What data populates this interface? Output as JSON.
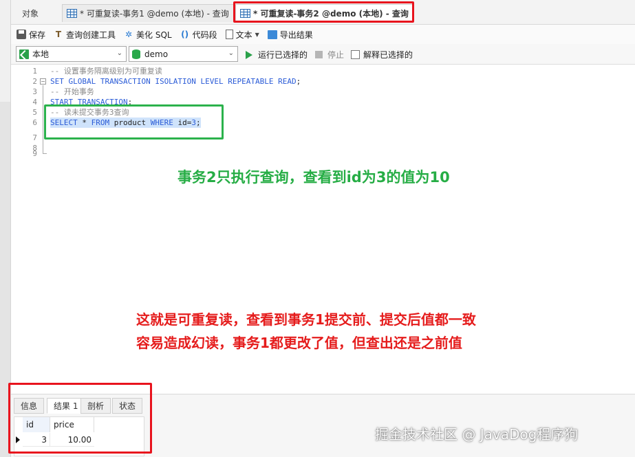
{
  "tabs": [
    {
      "label": "对象"
    },
    {
      "label": "* 可重复读-事务1 @demo (本地) - 查询"
    },
    {
      "label": "* 可重复读-事务2 @demo (本地) - 查询"
    }
  ],
  "toolbar": {
    "save": "保存",
    "query_builder": "查询创建工具",
    "beautify": "美化 SQL",
    "snippet": "代码段",
    "text": "文本",
    "export": "导出结果"
  },
  "connbar": {
    "connection": "本地",
    "database": "demo",
    "run_selected": "运行已选择的",
    "stop": "停止",
    "explain_selected": "解释已选择的"
  },
  "editor": {
    "line_numbers": [
      "1",
      "2",
      "3",
      "4",
      "5",
      "6",
      "7",
      "8",
      "9"
    ],
    "lines": {
      "l1": "-- 设置事务隔离级别为可重复读",
      "l2_kw": "SET GLOBAL TRANSACTION ISOLATION LEVEL REPEATABLE READ",
      "l2_end": ";",
      "l3": "-- 开始事务",
      "l4_kw": "START TRANSACTION",
      "l4_end": ";",
      "l5": "-- 读未提交事务3查询",
      "l6_select": "SELECT",
      "l6_star": " * ",
      "l6_from": "FROM",
      "l6_table": " product ",
      "l6_where": "WHERE",
      "l6_cond": " id",
      "l6_eq": "=",
      "l6_val": "3",
      "l6_end": ";"
    }
  },
  "annotations": {
    "green": "事务2只执行查询，查看到id为3的值为10",
    "red_line1": "这就是可重复读，查看到事务1提交前、提交后值都一致",
    "red_line2": "容易造成幻读，事务1都更改了值，但查出还是之前值"
  },
  "results": {
    "tabs": [
      "信息",
      "结果 1",
      "剖析",
      "状态"
    ],
    "columns": [
      "id",
      "price"
    ],
    "rows": [
      [
        "3",
        "10.00"
      ]
    ]
  },
  "watermark": "掘金技术社区 @ JavaDog程序狗",
  "colors": {
    "tab_highlight": "#e8131d",
    "code_highlight": "#2bb24c",
    "keyword": "#2a5bd7",
    "comment": "#8a8a8a",
    "selection": "#cfe3fb"
  },
  "icons": {
    "tab": "grid-icon",
    "save": "save-icon",
    "query_builder": "hammer-icon",
    "beautify": "magic-wand-icon",
    "snippet": "code-brackets-icon",
    "text": "document-icon",
    "export": "export-icon",
    "connection": "connection-icon",
    "database": "database-icon",
    "run": "play-icon",
    "stop": "stop-icon",
    "explain": "explain-icon"
  }
}
